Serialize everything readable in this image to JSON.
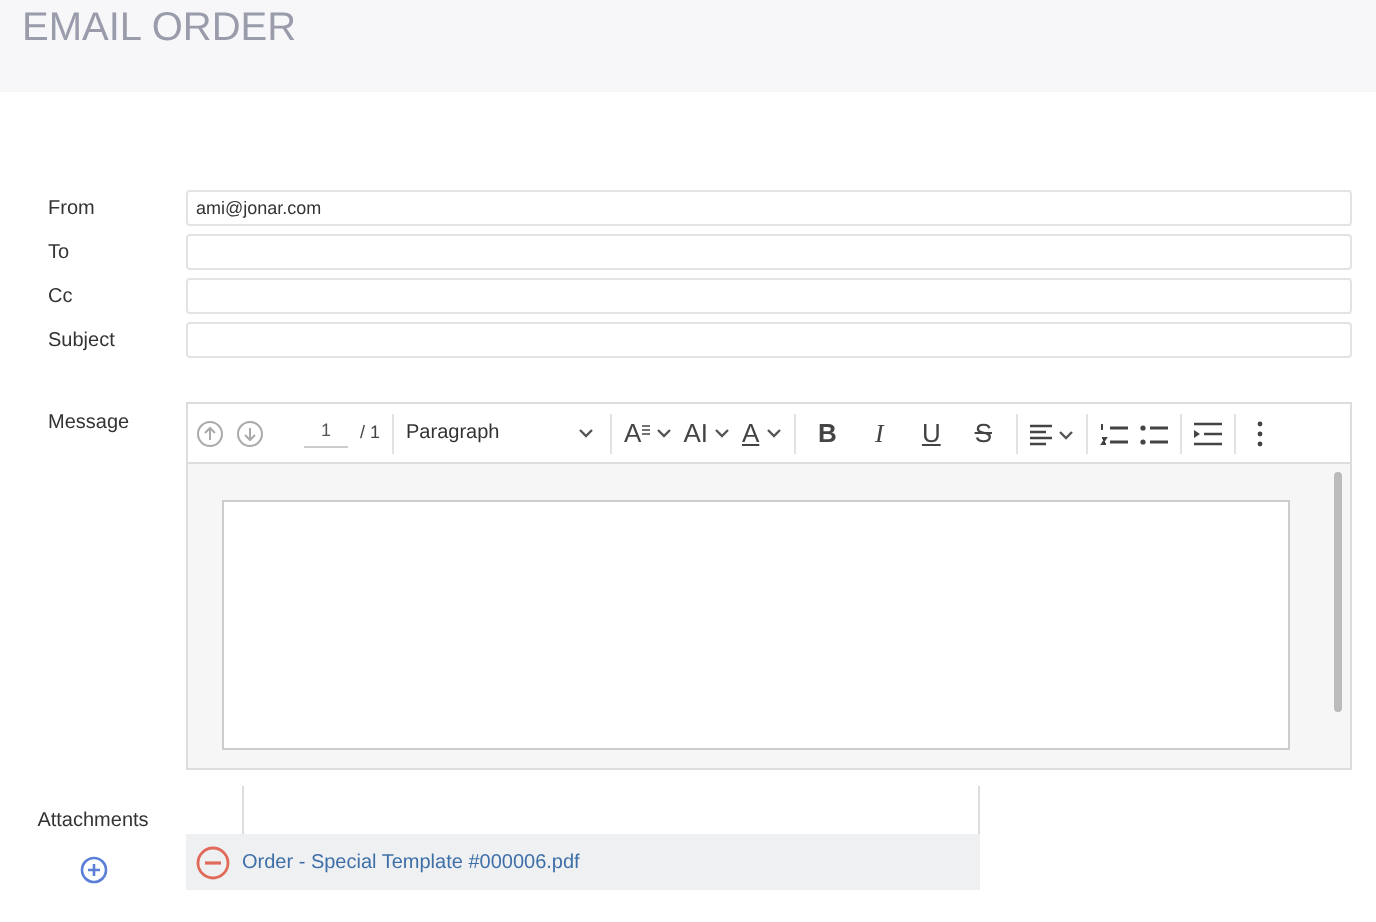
{
  "title": "EMAIL ORDER",
  "fields": [
    {
      "label": "From",
      "value": "ami@jonar.com"
    },
    {
      "label": "To"
    },
    {
      "label": "Cc"
    },
    {
      "label": "Subject"
    }
  ],
  "message": {
    "label": "Message",
    "toolbar": [
      {
        "kind": "up"
      },
      {
        "kind": "down"
      },
      {
        "kind": "page",
        "value": "1"
      },
      {
        "kind": "text",
        "text": "/ 1"
      },
      {
        "kind": "sep"
      },
      {
        "kind": "select",
        "text": "Paragraph"
      },
      {
        "kind": "sep"
      },
      {
        "kind": "fontsize",
        "text": "A"
      },
      {
        "kind": "fontcase",
        "text": "AI"
      },
      {
        "kind": "textcolor",
        "text": "A"
      },
      {
        "kind": "sep"
      },
      {
        "kind": "bold",
        "text": "B"
      },
      {
        "kind": "italic",
        "text": "I"
      },
      {
        "kind": "underline",
        "text": "U"
      },
      {
        "kind": "strike",
        "text": "S"
      },
      {
        "kind": "sep"
      },
      {
        "kind": "align"
      },
      {
        "kind": "sep"
      },
      {
        "kind": "olist"
      },
      {
        "kind": "ulist"
      },
      {
        "kind": "sep"
      },
      {
        "kind": "indent"
      },
      {
        "kind": "sep"
      },
      {
        "kind": "more"
      }
    ]
  },
  "attachments": {
    "label": "Attachments",
    "files": [
      {
        "name": "Order - Special Template #000006.pdf"
      }
    ]
  }
}
